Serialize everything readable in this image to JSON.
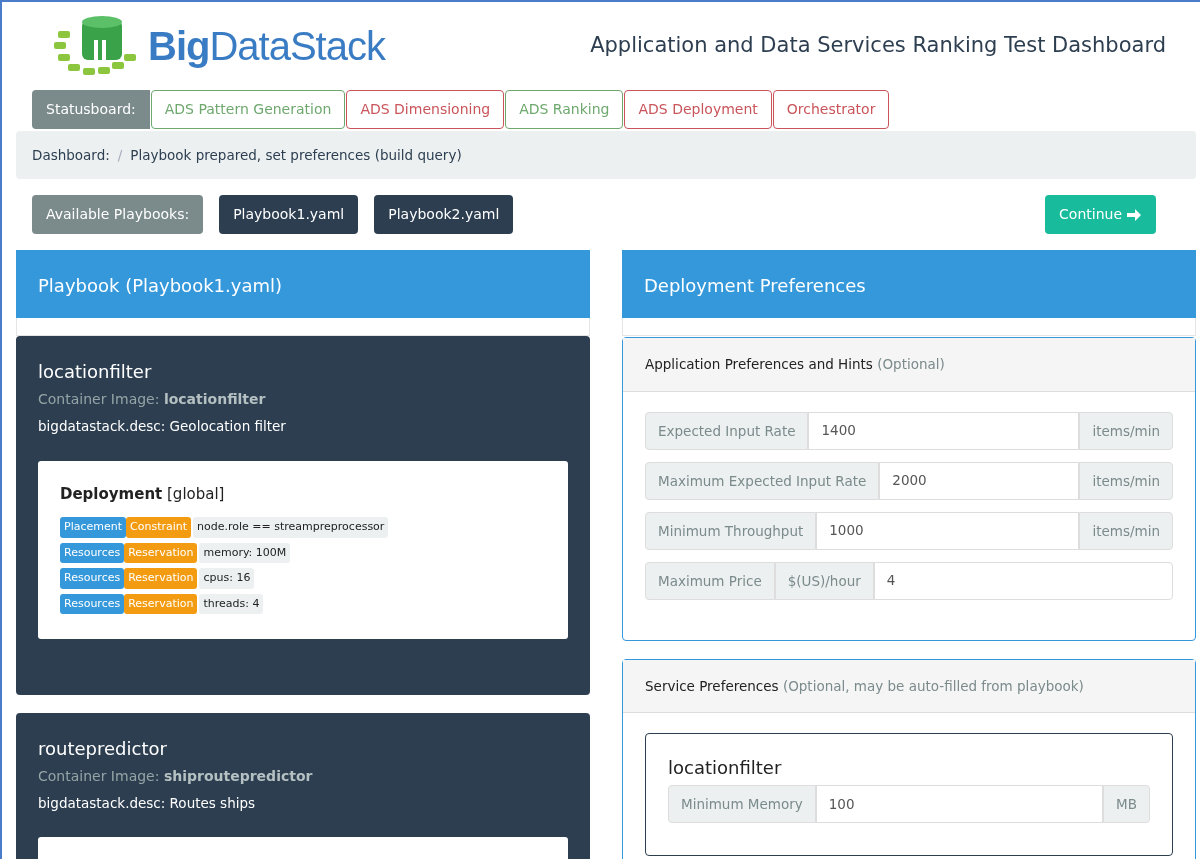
{
  "logo": {
    "text": "**Big**DataStack"
  },
  "title": "Application and Data Services Ranking Test Dashboard",
  "statusboard": {
    "label": "Statusboard:",
    "stages": [
      {
        "label": "ADS Pattern Generation",
        "complete": true
      },
      {
        "label": "ADS Dimensioning",
        "complete": false
      },
      {
        "label": "ADS Ranking",
        "complete": true
      },
      {
        "label": "ADS Deployment",
        "complete": false
      },
      {
        "label": "Orchestrator",
        "complete": false
      }
    ]
  },
  "breadcrumb": {
    "items": [
      "Dashboard:",
      "Playbook prepared, set preferences (build query)"
    ],
    "separator": "/"
  },
  "playbooks": {
    "label": "Available Playbooks:",
    "files": [
      "Playbook1.yaml",
      "Playbook2.yaml"
    ],
    "continue": "Continue"
  },
  "playbook_panel": {
    "title": "Playbook (Playbook1.yaml)",
    "services": [
      {
        "name": "locationfilter",
        "image": "Container Image: **locationfilter**",
        "desc": "bigdatastack.desc: Geolocation filter",
        "deployment": {
          "title": "**Deployment** [global]",
          "rules": [
            {
              "category": "Placement",
              "type": "Constraint",
              "value": "node.role == streampreprocessor"
            },
            {
              "category": "Resources",
              "type": "Reservation",
              "value": "memory: 100M"
            },
            {
              "category": "Resources",
              "type": "Reservation",
              "value": "cpus: 16"
            },
            {
              "category": "Resources",
              "type": "Reservation",
              "value": "threads: 4"
            }
          ]
        }
      },
      {
        "name": "routepredictor",
        "image": "Container Image: **shiproutepredictor**",
        "desc": "bigdatastack.desc: Routes ships"
      }
    ]
  },
  "preferences_panel": {
    "title": "Deployment Preferences",
    "application": {
      "title": "Application Preferences and Hints",
      "note": "(Optional)",
      "fields": [
        {
          "label": "Expected Input Rate",
          "value": "1400",
          "unit": "items/min",
          "kind": "suffix"
        },
        {
          "label": "Maximum Expected Input Rate",
          "value": "2000",
          "unit": "items/min",
          "kind": "suffix"
        },
        {
          "label": "Minimum Throughput",
          "value": "1000",
          "unit": "items/min",
          "kind": "suffix"
        },
        {
          "label": "Maximum Price",
          "value": "4",
          "unit": "$(US)/hour",
          "kind": "prefix"
        }
      ]
    },
    "service": {
      "title": "Service Preferences",
      "note": "(Optional, may be auto-filled from playbook)",
      "services": [
        {
          "name": "locationfilter",
          "fields": [
            {
              "label": "Minimum Memory",
              "value": "100",
              "unit": "MB",
              "kind": "suffix"
            }
          ]
        }
      ]
    }
  }
}
